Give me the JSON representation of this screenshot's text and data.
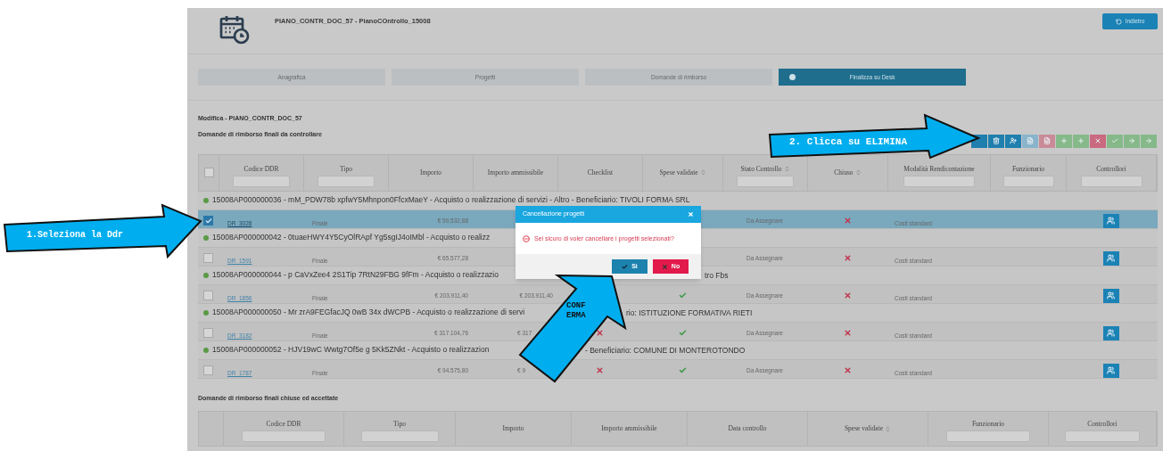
{
  "header": {
    "title": "PIANO_CONTR_DOC_57 - PianoCOntrollo_15008",
    "back_button": "Indietro"
  },
  "tabs": [
    {
      "label": "Anagrafica",
      "selected": false
    },
    {
      "label": "Progetti",
      "selected": false
    },
    {
      "label": "Domande di rimborso",
      "selected": false
    },
    {
      "label": "Finalizza su Desk",
      "selected": true
    }
  ],
  "section_title": "Modifica - PIANO_CONTR_DOC_57",
  "pending": {
    "title": "Domande di rimborso finali da controllare",
    "toolbar": [
      {
        "kind": "plain",
        "color": "#1f7fae"
      },
      {
        "kind": "trash",
        "color": "#1f7fae"
      },
      {
        "kind": "user",
        "color": "#1f7fae"
      },
      {
        "kind": "doc",
        "color": "#8ab4cc"
      },
      {
        "kind": "doc",
        "color": "#c98b98"
      },
      {
        "kind": "plus",
        "color": "#86b98a"
      },
      {
        "kind": "plus",
        "color": "#86b98a"
      },
      {
        "kind": "cross",
        "color": "#c96a80"
      },
      {
        "kind": "check",
        "color": "#86b98a"
      },
      {
        "kind": "arrow",
        "color": "#86b98a"
      },
      {
        "kind": "arrow",
        "color": "#86b98a"
      }
    ],
    "columns": [
      {
        "kind": "select",
        "checked": false
      },
      {
        "label": "Codice DDR",
        "filter": true,
        "sortable": false
      },
      {
        "label": "Tipo",
        "filter": true,
        "sortable": false
      },
      {
        "label": "Importo",
        "filter": false,
        "sortable": false
      },
      {
        "label": "Importo ammissibile",
        "filter": false,
        "sortable": false
      },
      {
        "label": "Checklist",
        "filter": false,
        "sortable": false
      },
      {
        "label": "Spese validate",
        "filter": false,
        "sortable": true
      },
      {
        "label": "Stato Controllo",
        "filter": true,
        "sortable": true
      },
      {
        "label": "Chiuso",
        "filter": false,
        "sortable": true
      },
      {
        "label": "Modalità Rendicontazione",
        "filter": true,
        "sortable": false
      },
      {
        "label": "Funzionario",
        "filter": true,
        "sortable": false
      },
      {
        "label": "Controllori",
        "filter": true,
        "sortable": false
      }
    ],
    "groups": [
      {
        "text": "15008AP000000036 - mM_PDW78b xpfwY5Mhnpon0FfcxMaeY - Acquisto o realizzazione di servizi - Altro - Beneficiario: TIVOLI FORMA SRL",
        "rows": [
          {
            "selected": true,
            "checked": true,
            "code": "DR_3028",
            "type": "Finale",
            "amount": "€ 59.532,88",
            "status": "Da Assegnare",
            "closed": false,
            "mode": "Costi standard"
          }
        ]
      },
      {
        "text": "15008AP000000042 - 0tuaeHWY4Y5CyOlRApf Yg5sgIJ4oIMbl - Acquisto o realizz",
        "rows": [
          {
            "selected": false,
            "checked": false,
            "code": "DR_1591",
            "type": "Finale",
            "amount": "€ 65.577,28",
            "status": "Da Assegnare",
            "closed": false,
            "mode": "Costi standard"
          }
        ]
      },
      {
        "text": "15008AP000000044 - p CaVxZee4 2S1Tip 7RtN29FBG 9fFm - Acquisto o realizzazio",
        "tail": "tro Fbs",
        "rows": [
          {
            "selected": false,
            "checked": false,
            "code": "DR_1856",
            "type": "Finale",
            "amount": "€ 203.911,40",
            "eligible": "€ 203.911,40",
            "validated": true,
            "status": "Da Assegnare",
            "closed": false,
            "mode": "Costi standard"
          }
        ]
      },
      {
        "text": "15008AP000000050 - Mr zrA9FEGfacJQ 0wB 34x dWCPB - Acquisto o realizzazione di servi",
        "tail": "rio: ISTITUZIONE FORMATIVA RIETI",
        "rows": [
          {
            "selected": false,
            "checked": false,
            "code": "DR_3182",
            "type": "Finale",
            "amount": "€ 317.104,76",
            "eligible": "€ 317",
            "checklist": false,
            "validated": true,
            "status": "Da Assegnare",
            "closed": false,
            "mode": "Costi standard"
          }
        ]
      },
      {
        "text": "15008AP000000052 - HJV19wC Wwtg7Of5e g 5Kk5ZNkt - Acquisto o realizzazion",
        "tail": "- Beneficiario: COMUNE DI MONTEROTONDO",
        "rows": [
          {
            "selected": false,
            "checked": false,
            "code": "DR_1787",
            "type": "Finale",
            "amount": "€ 94.575,80",
            "eligible": "€ 9",
            "checklist": false,
            "validated": true,
            "status": "Da Assegnare",
            "closed": false,
            "mode": "Costi standard"
          }
        ]
      }
    ]
  },
  "closed": {
    "title": "Domande di rimborso finali chiuse ed accettate",
    "columns": [
      {
        "label": "Codice DDR",
        "filter": true,
        "sortable": false
      },
      {
        "label": "Tipo",
        "filter": true,
        "sortable": false
      },
      {
        "label": "Importo",
        "filter": false,
        "sortable": false
      },
      {
        "label": "Importo ammissibile",
        "filter": false,
        "sortable": false
      },
      {
        "label": "Data controllo",
        "filter": false,
        "sortable": false
      },
      {
        "label": "Spese validate",
        "filter": false,
        "sortable": true
      },
      {
        "label": "Funzionario",
        "filter": true,
        "sortable": false
      },
      {
        "label": "Controllori",
        "filter": true,
        "sortable": false
      }
    ]
  },
  "dialog": {
    "title": "Cancellazione progetti",
    "message": "Sei sicuro di voler cancellare i progetti selezionati?",
    "buttons": [
      {
        "label": "Sì",
        "kind": "confirm"
      },
      {
        "label": "No",
        "kind": "cancel"
      }
    ]
  },
  "callouts": [
    {
      "kind": "left",
      "text": "1.Seleziona la Ddr"
    },
    {
      "kind": "toolbar",
      "text": "2. Clicca su ELIMINA"
    },
    {
      "kind": "diagonal",
      "text": "CONF\nERMA"
    }
  ]
}
